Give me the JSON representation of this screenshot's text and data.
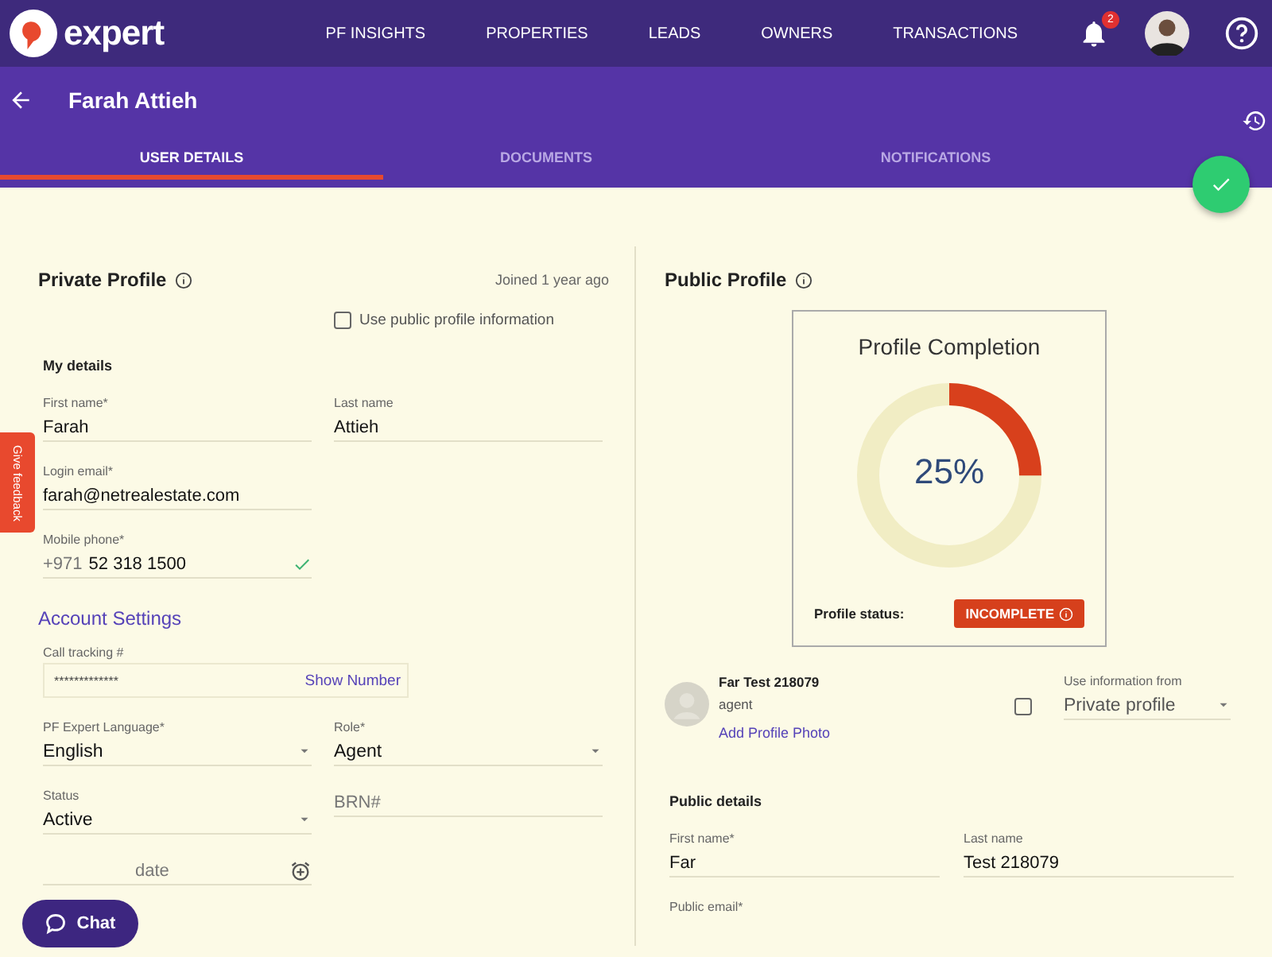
{
  "app": {
    "logo": "expert",
    "nav": [
      {
        "label": "PF INSIGHTS"
      },
      {
        "label": "PROPERTIES"
      },
      {
        "label": "LEADS"
      },
      {
        "label": "OWNERS"
      },
      {
        "label": "TRANSACTIONS"
      }
    ],
    "notification_count": "2"
  },
  "page": {
    "title": "Farah Attieh",
    "tabs": [
      {
        "label": "USER DETAILS",
        "selected": true
      },
      {
        "label": "DOCUMENTS",
        "selected": false
      },
      {
        "label": "NOTIFICATIONS",
        "selected": false
      }
    ]
  },
  "private_profile": {
    "title": "Private Profile",
    "joined": "Joined 1 year ago",
    "use_public": {
      "label": "Use public profile information",
      "checked": false
    },
    "heading": "My details",
    "rows": [
      [
        {
          "kind": "text",
          "label": "First name*",
          "value": "Farah"
        },
        {
          "kind": "text",
          "label": "Last name",
          "value": "Attieh"
        }
      ],
      [
        {
          "kind": "text",
          "label": "Login email*",
          "value": "farah@netrealestate.com"
        }
      ],
      [
        {
          "kind": "phone",
          "label": "Mobile phone*",
          "prefix": "+971",
          "value": "52 318 1500",
          "verified": true
        }
      ]
    ]
  },
  "account_settings": {
    "title": "Account Settings",
    "call_tracking": {
      "label": "Call tracking #",
      "value": "*************",
      "action": "Show Number"
    },
    "rows": [
      [
        {
          "kind": "select",
          "label": "PF Expert Language*",
          "value": "English"
        },
        {
          "kind": "select",
          "label": "Role*",
          "value": "Agent"
        }
      ],
      [
        {
          "kind": "select",
          "label": "Status",
          "value": "Active"
        },
        {
          "kind": "text",
          "placeholder": "BRN#"
        }
      ],
      [
        {
          "kind": "date",
          "placeholder": "date"
        }
      ]
    ]
  },
  "public_profile": {
    "title": "Public Profile",
    "completion": {
      "title": "Profile Completion",
      "level": 0.25,
      "percent": "25%",
      "status_label": "Profile status:",
      "status": "INCOMPLETE"
    },
    "agent": {
      "name": "Far Test 218079",
      "role": "agent",
      "add_photo": "Add Profile Photo",
      "use_info": {
        "checked": false,
        "label": "Use information from",
        "value": "Private profile"
      }
    },
    "heading": "Public details",
    "rows": [
      [
        {
          "kind": "text",
          "label": "First name*",
          "value": "Far"
        },
        {
          "kind": "text",
          "label": "Last name",
          "value": "Test 218079"
        }
      ],
      [
        {
          "kind": "text",
          "label": "Public email*"
        }
      ]
    ]
  },
  "feedback": "Give feedback",
  "chat": "Chat"
}
